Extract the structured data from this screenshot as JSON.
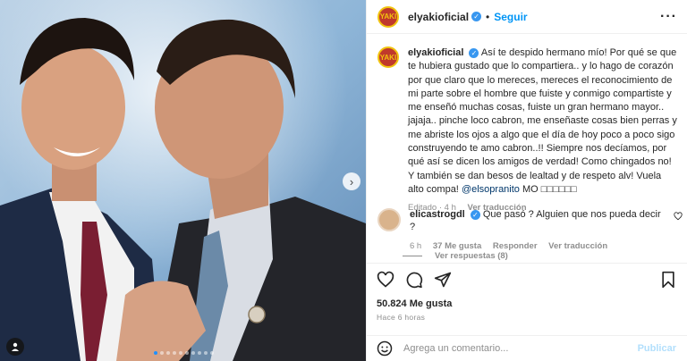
{
  "post": {
    "username": "elyakioficial",
    "separator": "•",
    "follow_label": "Seguir",
    "more_label": "···",
    "avatar_text": "YAKI",
    "verified_glyph": "✓"
  },
  "caption": {
    "username": "elyakioficial",
    "text": "Así te despido hermano mío! Por qué se que te hubiera gustado que lo compartiera.. y lo hago de corazón por que claro que lo mereces, mereces el reconocimiento de mi parte sobre el hombre que fuiste y conmigo compartiste y me enseñó muchas cosas, fuiste un gran hermano mayor.. jajaja.. pinche loco cabron, me enseñaste cosas bien perras y me abriste los ojos a algo que el día de hoy poco a poco sigo construyendo te amo cabron..!! Siempre nos decíamos, por qué así se dicen los amigos de verdad! Como chingados no! Y también se dan besos de lealtad y de respeto alv! Vuela alto compa!",
    "mention": "@elsopranito",
    "tail": "MO",
    "tail_boxes": "□□□□□□",
    "meta_edited": "Editado · 4 h",
    "meta_translate": "Ver traducción"
  },
  "comment": {
    "username": "elicastrogdl",
    "text": "Que pasó ? Alguien que nos pueda decir ?",
    "time": "6 h",
    "likes": "37 Me gusta",
    "reply": "Responder",
    "translate": "Ver traducción",
    "view_replies": "Ver respuestas (8)"
  },
  "engagement": {
    "likes": "50.824 Me gusta",
    "time_ago": "Hace 6 horas"
  },
  "add_comment": {
    "placeholder": "Agrega un comentario...",
    "post_label": "Publicar"
  },
  "carousel": {
    "total": 10,
    "active_index": 0,
    "next_glyph": "›"
  },
  "colors": {
    "accent": "#0095f6",
    "verified": "#3897f0",
    "muted": "#8e8e8e"
  },
  "icons": [
    "heart-icon",
    "comment-icon",
    "share-icon",
    "bookmark-icon",
    "emoji-icon",
    "tag-user-icon",
    "chevron-right-icon",
    "verified-icon",
    "more-icon"
  ]
}
